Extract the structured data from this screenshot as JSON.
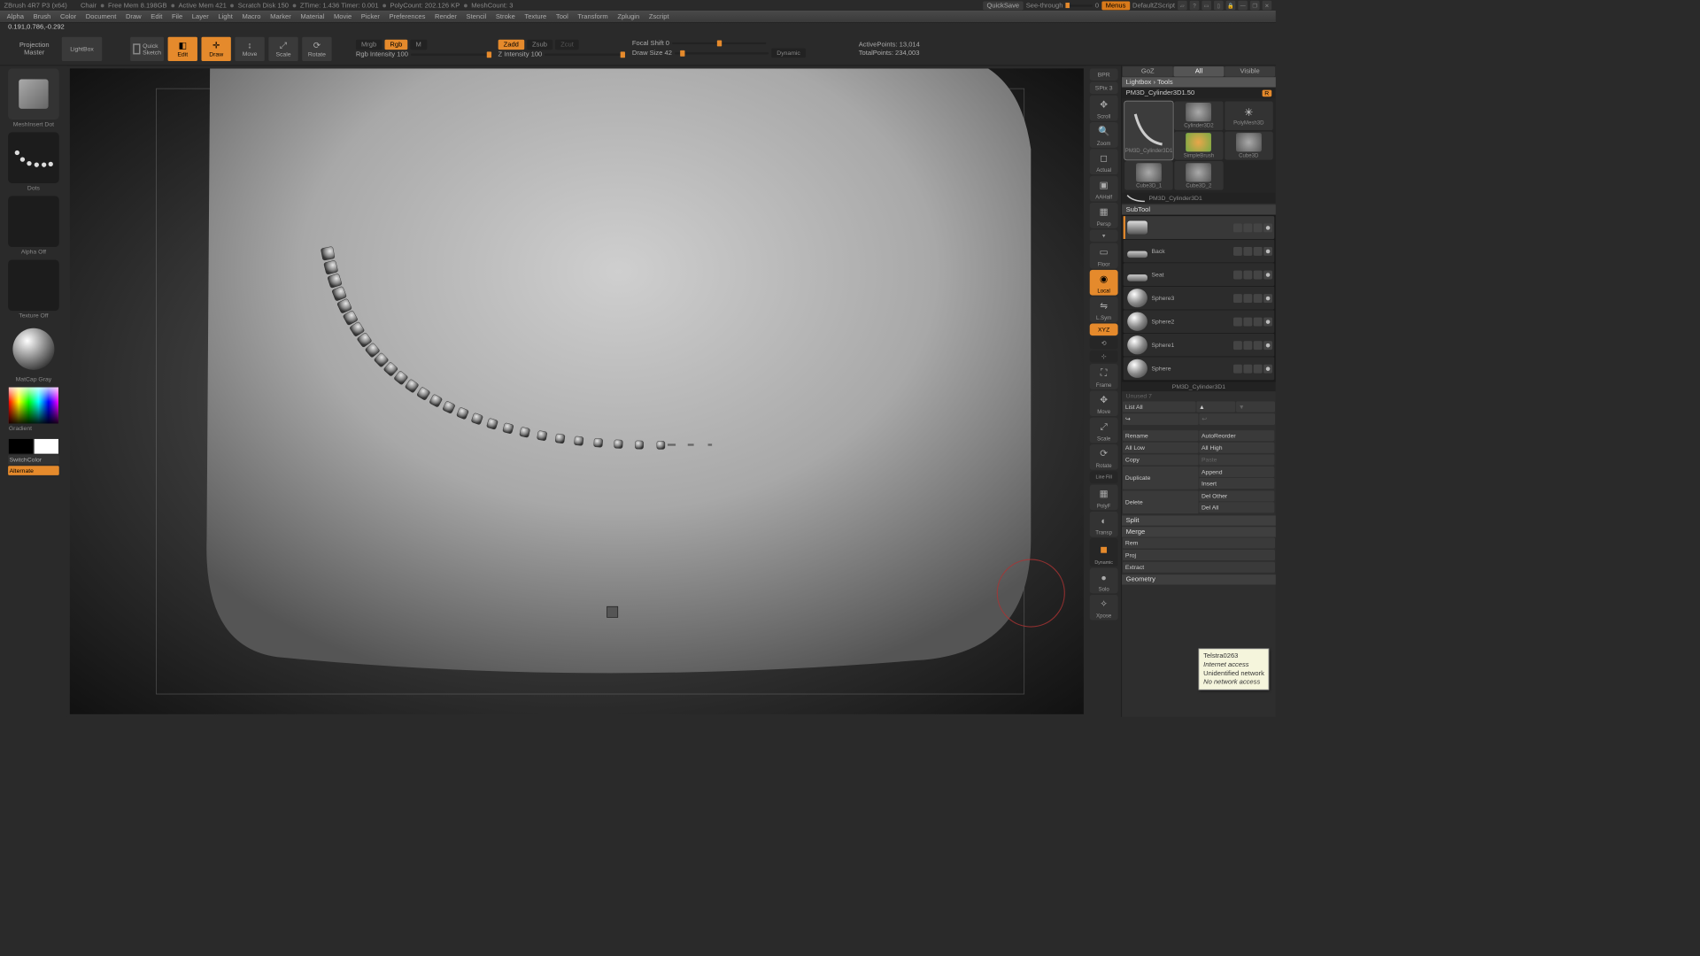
{
  "title_bar": {
    "app": "ZBrush 4R7 P3 (x64)",
    "doc": "Chair",
    "free_mem": "Free Mem 8.198GB",
    "active_mem": "Active Mem 421",
    "scratch": "Scratch Disk 150",
    "ztime": "ZTime: 1.436 Timer: 0.001",
    "polycount": "PolyCount: 202.126 KP",
    "meshcount": "MeshCount: 3",
    "quicksave": "QuickSave",
    "seethrough": "See-through",
    "seethrough_val": "0",
    "menus": "Menus",
    "zscript": "DefaultZScript"
  },
  "menu": [
    "Alpha",
    "Brush",
    "Color",
    "Document",
    "Draw",
    "Edit",
    "File",
    "Layer",
    "Light",
    "Macro",
    "Marker",
    "Material",
    "Movie",
    "Picker",
    "Preferences",
    "Render",
    "Stencil",
    "Stroke",
    "Texture",
    "Tool",
    "Transform",
    "Zplugin",
    "Zscript"
  ],
  "coords": "0.191,0.786,-0.292",
  "shelf": {
    "projection_master": "Projection\nMaster",
    "lightbox": "LightBox",
    "quick_sketch": "Quick\nSketch",
    "edit": "Edit",
    "draw": "Draw",
    "move": "Move",
    "scale": "Scale",
    "rotate": "Rotate",
    "mrgb": "Mrgb",
    "rgb": "Rgb",
    "m": "M",
    "rgb_intensity": "Rgb Intensity 100",
    "zadd": "Zadd",
    "zsub": "Zsub",
    "zcut": "Zcut",
    "z_intensity": "Z Intensity 100",
    "focal_shift": "Focal Shift 0",
    "draw_size": "Draw Size 42",
    "dynamic": "Dynamic",
    "active_points": "ActivePoints: 13,014",
    "total_points": "TotalPoints: 234,003"
  },
  "left": {
    "brush_name": "MeshInsert Dot",
    "stroke": "Dots",
    "alpha": "Alpha Off",
    "texture": "Texture Off",
    "matcap": "MatCap Gray",
    "gradient": "Gradient",
    "switchcolor": "SwitchColor",
    "alternate": "Alternate"
  },
  "rtools": [
    "BPR",
    "SPix 3",
    "Scroll",
    "Zoom",
    "Actual",
    "AAHalf",
    "Persp",
    "Floor",
    "Local",
    "L.Sym",
    "XYZ",
    "Frame",
    "Move",
    "Scale",
    "Rotate",
    "PolyF",
    "Transp",
    "Solo",
    "Xpose"
  ],
  "right_tabs": {
    "goz": "GoZ",
    "all": "All",
    "visible": "Visible"
  },
  "breadcrumb": "Lightbox › Tools",
  "tool_name": "PM3D_Cylinder3D1.50",
  "tool_grid": [
    {
      "label": "PM3D_Cylinder3D1"
    },
    {
      "label": "Cylinder3D2"
    },
    {
      "label": "PolyMesh3D"
    },
    {
      "label": "SimpleBrush"
    },
    {
      "label": "Cube3D"
    },
    {
      "label": "Cube3D_1"
    },
    {
      "label": "Cube3D_2"
    }
  ],
  "subtool_head": "SubTool",
  "subtools": [
    {
      "label": "",
      "sel": true,
      "thumb": "cyl"
    },
    {
      "label": "Back",
      "thumb": "flat"
    },
    {
      "label": "Seat",
      "thumb": "flat"
    },
    {
      "label": "Sphere3",
      "thumb": "sphere"
    },
    {
      "label": "Sphere2",
      "thumb": "sphere"
    },
    {
      "label": "Sphere1",
      "thumb": "sphere"
    },
    {
      "label": "Sphere",
      "thumb": "sphere"
    }
  ],
  "subtool_footer": "PM3D_Cylinder3D1",
  "list_all": "List All",
  "sub_buttons": {
    "rename": "Rename",
    "auto": "AutoReorder",
    "alllow": "All Low",
    "allhigh": "All High",
    "copy": "Copy",
    "paste": "Paste",
    "duplicate": "Duplicate",
    "append": "Append",
    "insert": "Insert",
    "delete": "Delete",
    "delother": "Del Other",
    "delall": "Del All",
    "split": "Split",
    "merge": "Merge",
    "remesh": "Rem",
    "project": "Proj",
    "extract": "Extract",
    "geometry": "Geometry"
  },
  "popup": {
    "line1": "Telstra0263",
    "line2": "Internet access",
    "line3": "Unidentified network",
    "line4": "No network access"
  }
}
